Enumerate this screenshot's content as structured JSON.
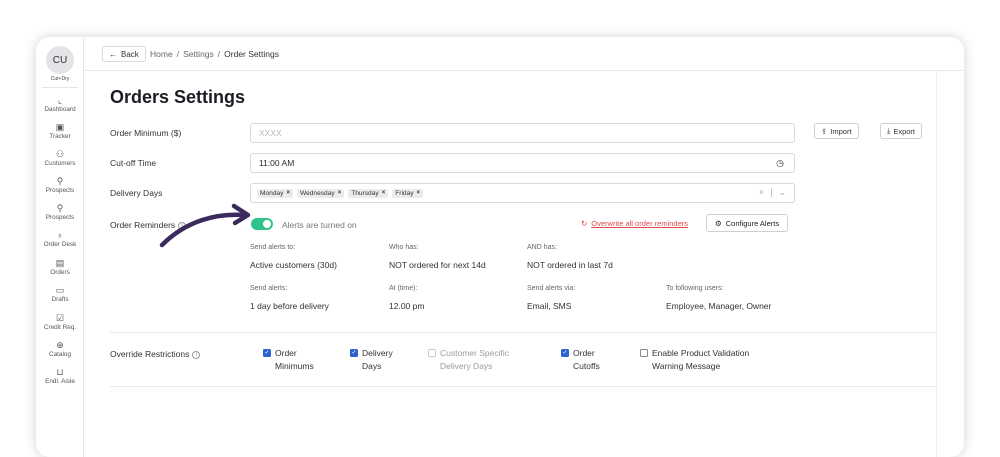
{
  "sidebar": {
    "avatar": "CU",
    "brand": "Cut+Dry",
    "items": [
      {
        "label": "Dashboard",
        "icon": "chart-icon"
      },
      {
        "label": "Tracker",
        "icon": "clipboard-icon"
      },
      {
        "label": "Customers",
        "icon": "users-icon"
      },
      {
        "label": "Prospects",
        "icon": "user-plus-icon"
      },
      {
        "label": "Prospects",
        "icon": "user-plus-icon"
      },
      {
        "label": "Order Desk",
        "icon": "pin-icon"
      },
      {
        "label": "Orders",
        "icon": "document-icon"
      },
      {
        "label": "Drafts",
        "icon": "file-icon"
      },
      {
        "label": "Credit Req.",
        "icon": "check-square-icon"
      },
      {
        "label": "Catalog",
        "icon": "compass-icon"
      },
      {
        "label": "Endl. Aisle",
        "icon": "cart-icon"
      }
    ]
  },
  "topbar": {
    "back_label": "Back",
    "breadcrumb": [
      "Home",
      "Settings",
      "Order Settings"
    ]
  },
  "page": {
    "title": "Orders Settings",
    "import_label": "Import",
    "export_label": "Export"
  },
  "form": {
    "order_minimum_label": "Order Minimum ($)",
    "order_minimum_placeholder": "XXXX",
    "cutoff_label": "Cut-off Time",
    "cutoff_value": "11:00 AM",
    "delivery_days_label": "Delivery Days",
    "delivery_days": [
      "Monday",
      "Wednesday",
      "Thursday",
      "Friday"
    ],
    "reminders_label": "Order Reminders",
    "alerts_status": "Alerts are turned on",
    "overwrite_label": "Overwrite all order reminders",
    "configure_label": "Configure Alerts"
  },
  "alerts": {
    "send_to_label": "Send alerts to:",
    "send_to_value": "Active customers (30d)",
    "who_has_label": "Who has:",
    "who_has_value": "NOT ordered for next 14d",
    "and_has_label": "AND has:",
    "and_has_value": "NOT ordered in last 7d",
    "send_alerts_label": "Send alerts:",
    "send_alerts_value": "1 day before delivery",
    "at_time_label": "At (time):",
    "at_time_value": "12.00 pm",
    "via_label": "Send alerts via:",
    "via_value": "Email, SMS",
    "users_label": "To following users:",
    "users_value": "Employee, Manager, Owner"
  },
  "restrictions": {
    "label": "Override Restrictions",
    "options": [
      {
        "label": "Order\nMinimums",
        "checked": true,
        "disabled": false
      },
      {
        "label": "Delivery\nDays",
        "checked": true,
        "disabled": false
      },
      {
        "label": "Customer Specific\nDelivery Days",
        "checked": false,
        "disabled": true
      },
      {
        "label": "Order\nCutoffs",
        "checked": true,
        "disabled": false
      },
      {
        "label": "Enable Product Validation\nWarning Message",
        "checked": false,
        "disabled": false
      }
    ]
  },
  "colors": {
    "toggle_on": "#2fc28c",
    "checkbox_on": "#2f5fd0",
    "danger": "#e04a4a",
    "arrow": "#3b2a5c"
  }
}
